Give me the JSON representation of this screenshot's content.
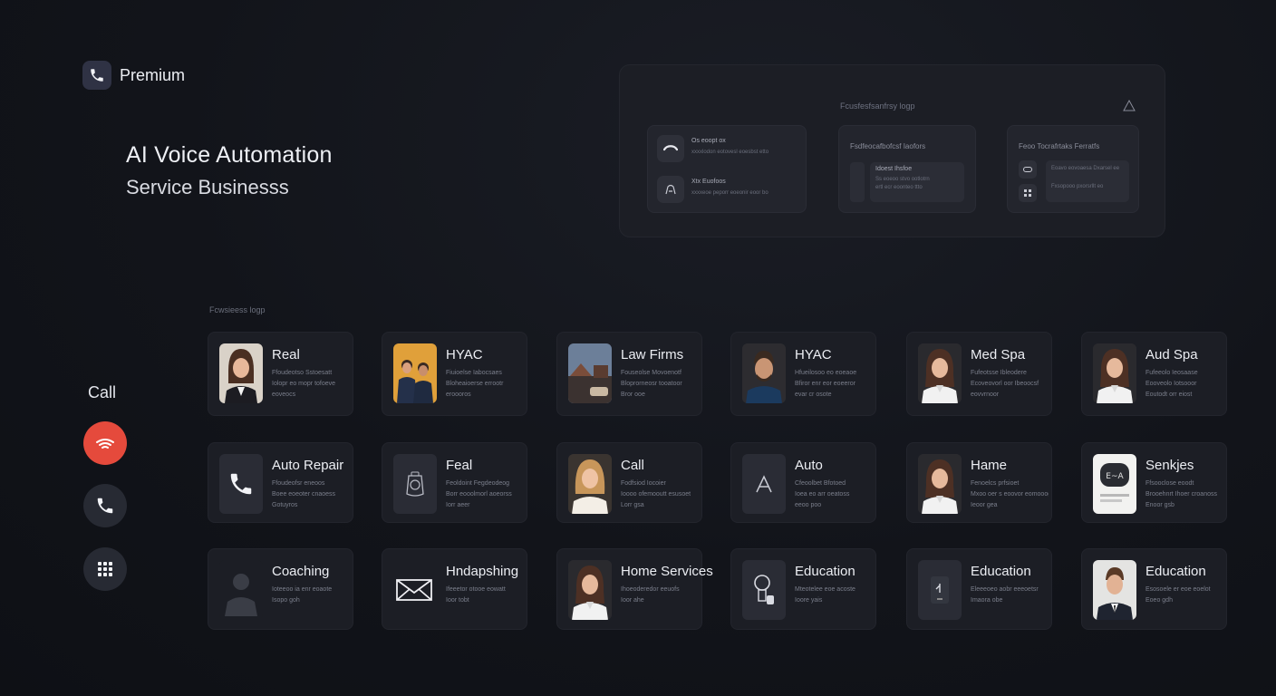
{
  "brand": {
    "label": "Premium",
    "icon": "phone-icon"
  },
  "hero": {
    "title": "AI Voice Automation",
    "subtitle": "Service Businesss"
  },
  "panel": {
    "title": "Fcusfesfsanfrsy logp",
    "card1": {
      "rows": [
        {
          "title": "Os eoopt ox",
          "text": "xxxxlodon eotovesl eoesbst etto",
          "icon": "headset-icon"
        },
        {
          "title": "Xtx  Euofoos",
          "text": "xxxxeoe peporr eoeonir eoor bo",
          "icon": "support-icon"
        }
      ]
    },
    "card2": {
      "head": "Fsdfeocafbofcsf Iaofors",
      "box_title": "Idoest Ihsfoe",
      "box_text": [
        "Ss eoeoo stvo ootlotrn",
        "ertl ecr eoonteo ttto"
      ]
    },
    "card3": {
      "head": "Feoo  Tocrafrtaks Ferratfs",
      "rows": [
        "Eoavo eovoaesa Dxarsel ee",
        "Fxsopooo pxorsrllt eo"
      ]
    }
  },
  "section_label": "Fcwsieess logp",
  "call": {
    "label": "Call"
  },
  "cards": [
    {
      "title": "Real",
      "desc": [
        "Ffoudeotso Sstoesatt",
        "Iolopr eo mopr tofoeve",
        "eoveocs"
      ],
      "thumb": "woman-suit"
    },
    {
      "title": "HYAC",
      "desc": [
        "Fiuioelse Iabocsaes",
        "Bloheaioerse errootr",
        "eroooros"
      ],
      "thumb": "team-photo"
    },
    {
      "title": "Law Firms",
      "desc": [
        "Fouseolse Movoenotf",
        "Bloprorneosr tooatoor",
        "Bror ooe"
      ],
      "thumb": "building-photo"
    },
    {
      "title": "HYAC",
      "desc": [
        "Hfueilosoo eo eoeaoe",
        "Bfiror enr eor eoeeror",
        "evar cr osote"
      ],
      "thumb": "man-portrait"
    },
    {
      "title": "Med Spa",
      "desc": [
        "Fufeotsse Ibleodere",
        "Ecoveovorl oor Ibeoocsf",
        "eovvrnoor"
      ],
      "thumb": "woman-white"
    },
    {
      "title": "Aud Spa",
      "desc": [
        "Fufeeolo Ieosaase",
        "Eooveolo Iotsooor",
        "Eoutodt orr eiost"
      ],
      "thumb": "woman-white"
    },
    {
      "title": "Auto Repair",
      "desc": [
        "Ffoudeofsr eneoos",
        "Boee eoeoter cnaoess",
        "Gotuyros"
      ],
      "thumb": "phone-tile"
    },
    {
      "title": "Feal",
      "desc": [
        "Feoldoint  Fegdeodeog",
        "Borr eooolmorl aoeorss",
        "Iorr aeer"
      ],
      "thumb": "badge-tile"
    },
    {
      "title": "Call",
      "desc": [
        "Fodfsiod Iocoier",
        "Ioooo ofemooutt esusoet",
        "Lorr gsa"
      ],
      "thumb": "woman-blonde"
    },
    {
      "title": "Auto",
      "desc": [
        "Cfeoolbet Bfotoed",
        "Ioea eo arr oeatoss",
        "eeoo poo"
      ],
      "thumb": "a-tile"
    },
    {
      "title": "Hame",
      "desc": [
        "Fenoelcs prfsioet",
        "Mxoo oer s eoovor eomooog",
        "Ieoor gea"
      ],
      "thumb": "woman-white"
    },
    {
      "title": "Senkjes",
      "desc": [
        "Ffsooclose eoodt",
        "Brooehnrt Ihoer croanoss",
        "Enoor gsb"
      ],
      "thumb": "card-tile"
    },
    {
      "title": "Coaching",
      "desc": [
        "Ioteeoo ia enr eoaote",
        "Isopo goh"
      ],
      "thumb": "silhouette"
    },
    {
      "title": "Hndapshing",
      "desc": [
        "Ifeeetor otooe eowatt",
        "Ioor tobt"
      ],
      "thumb": "envelope-tile"
    },
    {
      "title": "Home Services",
      "desc": [
        "Ihoeoderedor eeuofs",
        "Ioor ahe"
      ],
      "thumb": "woman-white"
    },
    {
      "title": "Education",
      "desc": [
        "Mteotelee eoe acoste",
        "Ioore yais"
      ],
      "thumb": "robot-tile"
    },
    {
      "title": "Education",
      "desc": [
        "Eleeeoeo aobr eeeoetsr",
        "Imaora obe"
      ],
      "thumb": "device-tile"
    },
    {
      "title": "Education",
      "desc": [
        "Esosoele er eoe eoelot",
        "Eoeo gdh"
      ],
      "thumb": "man-suit"
    }
  ],
  "colors": {
    "accent_red": "#e54a3c",
    "card_bg": "#1c1e25",
    "page_bg": "#12141a"
  }
}
